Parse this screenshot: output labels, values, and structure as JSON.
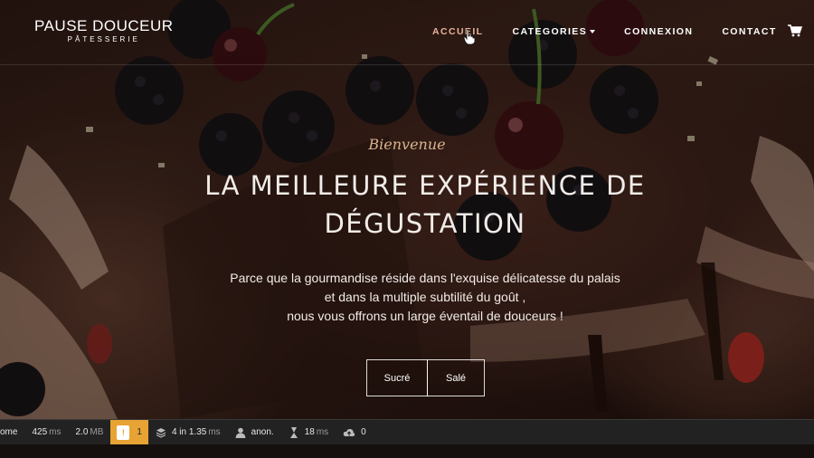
{
  "brand": {
    "name": "PAUSE DOUCEUR",
    "subtitle": "PÂTESSERIE"
  },
  "nav": {
    "items": [
      {
        "label": "ACCUEIL",
        "active": true
      },
      {
        "label": "CATEGORIES",
        "dropdown": true
      },
      {
        "label": "CONNEXION"
      },
      {
        "label": "CONTACT"
      }
    ],
    "cart_icon": "cart-icon"
  },
  "hero": {
    "welcome": "Bienvenue",
    "headline": "LA MEILLEURE EXPÉRIENCE DE DÉGUSTATION",
    "tagline": [
      "Parce que la gourmandise réside dans l'exquise délicatesse du palais",
      "et dans la multiple subtilité du goût ,",
      "nous vous offrons un large éventail de douceurs !"
    ],
    "buttons": {
      "sucre": "Sucré",
      "sale": "Salé"
    }
  },
  "debug_toolbar": {
    "route": "ome",
    "time": "425",
    "time_unit": "ms",
    "memory": "2.0",
    "memory_unit": "MB",
    "alerts": "1",
    "twig": "4 in 1.35",
    "twig_unit": "ms",
    "user": "anon.",
    "cache": "18",
    "cache_unit": "ms",
    "queries": "0"
  },
  "colors": {
    "accent": "#e9b39a",
    "toolbar_bg": "#222222",
    "alert": "#e8a335"
  }
}
